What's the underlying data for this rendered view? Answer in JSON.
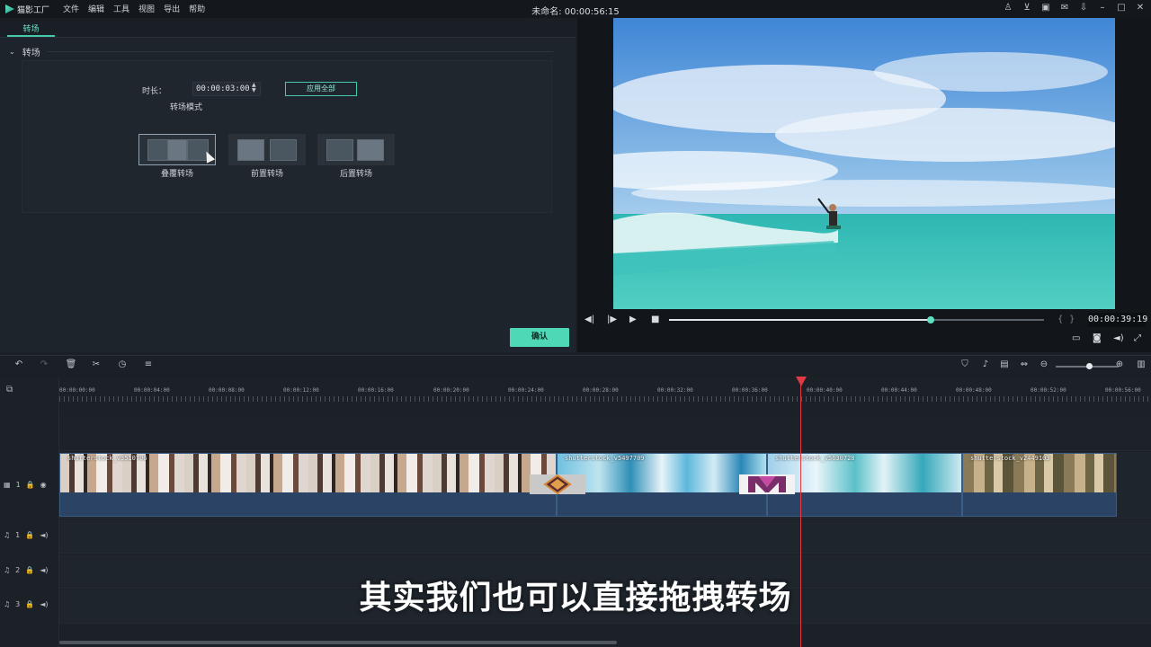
{
  "app": {
    "logo_text": "猫影工厂",
    "menu": [
      "文件",
      "编辑",
      "工具",
      "视图",
      "导出",
      "帮助"
    ],
    "document_title": "未命名: 00:00:56:15",
    "window_icons": [
      "user-icon",
      "cart-icon",
      "save-icon",
      "mail-icon",
      "download-icon",
      "minimize-icon",
      "maximize-icon",
      "close-icon"
    ]
  },
  "left_panel": {
    "tab_label": "转场",
    "section_label": "转场",
    "duration_label": "时长：",
    "duration_value": "00:00:03:00",
    "apply_all_label": "应用全部",
    "mode_label": "转场模式",
    "modes": [
      {
        "label": "叠覆转场",
        "selected": true
      },
      {
        "label": "前置转场",
        "selected": false
      },
      {
        "label": "后置转场",
        "selected": false
      }
    ],
    "confirm_label": "确认"
  },
  "preview": {
    "timecode": "00:00:39:19",
    "progress_fraction": 0.697,
    "controls": [
      "prev-frame-icon",
      "play-icon-small",
      "play-icon",
      "stop-icon"
    ],
    "right_icons": [
      "monitor-icon",
      "snapshot-icon",
      "volume-icon",
      "fullscreen-icon"
    ]
  },
  "timeline": {
    "toolbar_left": [
      "undo-icon",
      "redo-icon",
      "delete-icon",
      "cut-icon",
      "speed-icon",
      "adjust-icon"
    ],
    "toolbar_right": [
      "marker-icon",
      "mic-icon",
      "voiceover-icon",
      "detach-icon",
      "zoom-out-icon",
      "zoom-in-icon",
      "columns-icon"
    ],
    "ruler_labels": [
      "00:00:00:00",
      "00:00:04:00",
      "00:00:08:00",
      "00:00:12:00",
      "00:00:16:00",
      "00:00:20:00",
      "00:00:24:00",
      "00:00:28:00",
      "00:00:32:00",
      "00:00:36:00",
      "00:00:40:00",
      "00:00:44:00",
      "00:00:48:00",
      "00:00:52:00",
      "00:00:56:00"
    ],
    "clips": [
      {
        "name": "shutterstock_v3510706"
      },
      {
        "name": "shutterstock_v5497709"
      },
      {
        "name": "shutterstock_v5630728"
      },
      {
        "name": "shutterstock_v2449103"
      }
    ],
    "tracks": [
      {
        "label": "1",
        "kind": "video"
      },
      {
        "label": "1",
        "kind": "audio"
      },
      {
        "label": "2",
        "kind": "audio"
      },
      {
        "label": "3",
        "kind": "audio"
      }
    ]
  },
  "subtitle": "其实我们也可以直接拖拽转场"
}
